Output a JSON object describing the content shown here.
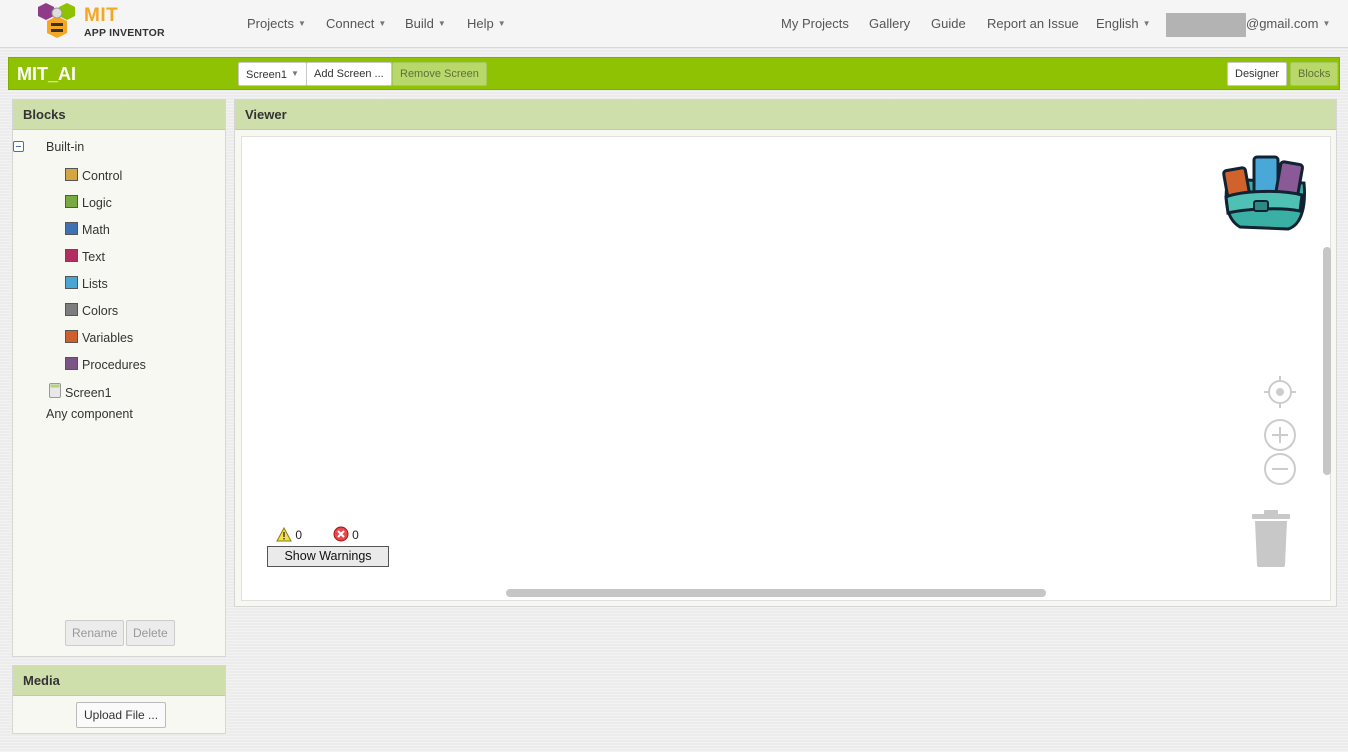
{
  "topbar": {
    "logo_title": "MIT",
    "logo_subtitle": "APP INVENTOR",
    "menus": [
      {
        "label": "Projects"
      },
      {
        "label": "Connect"
      },
      {
        "label": "Build"
      },
      {
        "label": "Help"
      }
    ],
    "links": [
      {
        "label": "My Projects"
      },
      {
        "label": "Gallery"
      },
      {
        "label": "Guide"
      },
      {
        "label": "Report an Issue"
      }
    ],
    "language": "English",
    "account_suffix": "@gmail.com"
  },
  "projectbar": {
    "project_name": "MIT_AI",
    "screen_select": "Screen1",
    "add_screen": "Add Screen ...",
    "remove_screen": "Remove Screen",
    "designer": "Designer",
    "blocks": "Blocks"
  },
  "blocks_panel": {
    "title": "Blocks",
    "builtin_label": "Built-in",
    "categories": [
      {
        "label": "Control",
        "color": "#d4a541"
      },
      {
        "label": "Logic",
        "color": "#77ab41"
      },
      {
        "label": "Math",
        "color": "#3f71b5"
      },
      {
        "label": "Text",
        "color": "#b32d5e"
      },
      {
        "label": "Lists",
        "color": "#49a6d4"
      },
      {
        "label": "Colors",
        "color": "#7d7d7d"
      },
      {
        "label": "Variables",
        "color": "#d05f2d"
      },
      {
        "label": "Procedures",
        "color": "#7c5385"
      }
    ],
    "screen_label": "Screen1",
    "any_component": "Any component",
    "rename": "Rename",
    "delete": "Delete"
  },
  "media_panel": {
    "title": "Media",
    "upload": "Upload File ..."
  },
  "viewer": {
    "title": "Viewer",
    "warnings_count": "0",
    "errors_count": "0",
    "show_warnings": "Show Warnings"
  },
  "icons": [
    "backpack-icon",
    "recenter-icon",
    "zoom-in-icon",
    "zoom-out-icon",
    "trash-icon",
    "warning-icon",
    "error-icon"
  ]
}
